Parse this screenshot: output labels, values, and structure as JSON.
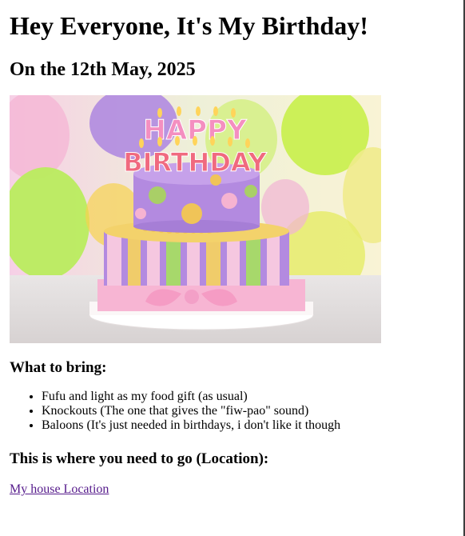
{
  "page": {
    "heading": "Hey Everyone, It's My Birthday!",
    "date_heading": "On the 12th May, 2025",
    "hero_image": {
      "alt": "Birthday cake with Happy Birthday candles",
      "candle_text_top": "HAPPY",
      "candle_text_bottom": "BIRTHDAY"
    },
    "bring_heading": "What to bring:",
    "bring_items": [
      "Fufu and light as my food gift (as usual)",
      "Knockouts (The one that gives the \"fiw-pao\" sound)",
      "Baloons (It's just needed in birthdays, i don't like it though"
    ],
    "location_heading": "This is where you need to go (Location):",
    "location_link": "My house Location"
  },
  "colors": {
    "link_visited": "#551a8b",
    "text": "#000000",
    "background": "#ffffff"
  }
}
